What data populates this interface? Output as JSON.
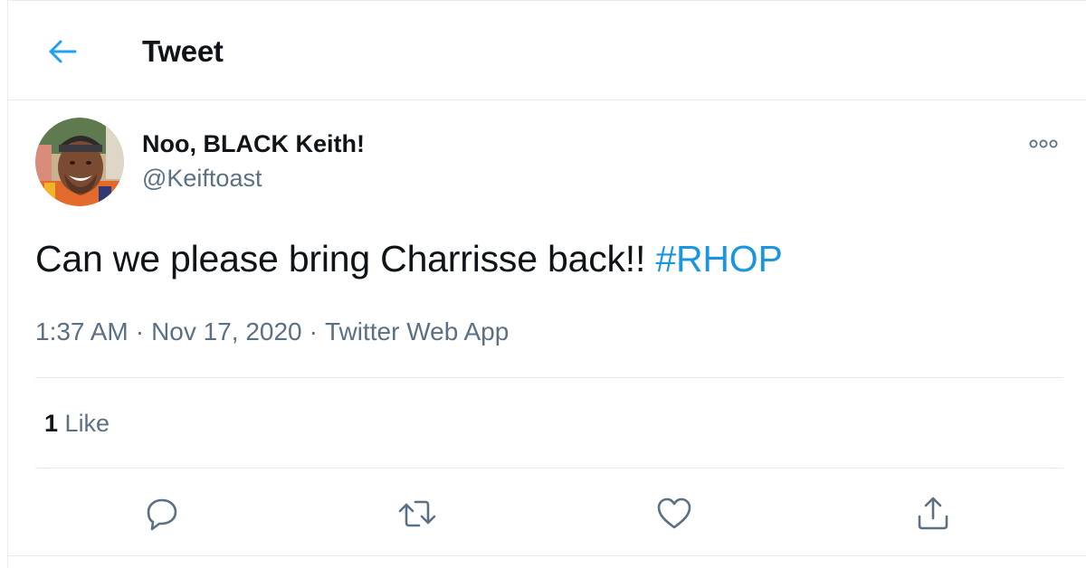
{
  "header": {
    "title": "Tweet",
    "back_icon": "arrow-left-icon",
    "accent": "#1da1f2"
  },
  "author": {
    "display_name": "Noo, BLACK Keith!",
    "handle": "@Keiftoast",
    "avatar_icon": "user-avatar"
  },
  "tweet": {
    "text": "Can we please bring Charrisse back!! ",
    "hashtag": "#RHOP",
    "hashtag_color": "#1b95e0",
    "time": "1:37 AM",
    "date": "Nov 17, 2020",
    "source": "Twitter Web App",
    "separator": "·"
  },
  "stats": {
    "likes_count": "1",
    "likes_label": "Like"
  },
  "actions": [
    {
      "name": "reply",
      "icon": "reply-icon"
    },
    {
      "name": "retweet",
      "icon": "retweet-icon"
    },
    {
      "name": "like",
      "icon": "heart-icon"
    },
    {
      "name": "share",
      "icon": "share-icon"
    }
  ],
  "more_icon": "more-options-icon",
  "colors": {
    "text_primary": "#0f1419",
    "text_secondary": "#5b7083",
    "border": "#e6ecf0",
    "icon_gray": "#5b7083"
  }
}
